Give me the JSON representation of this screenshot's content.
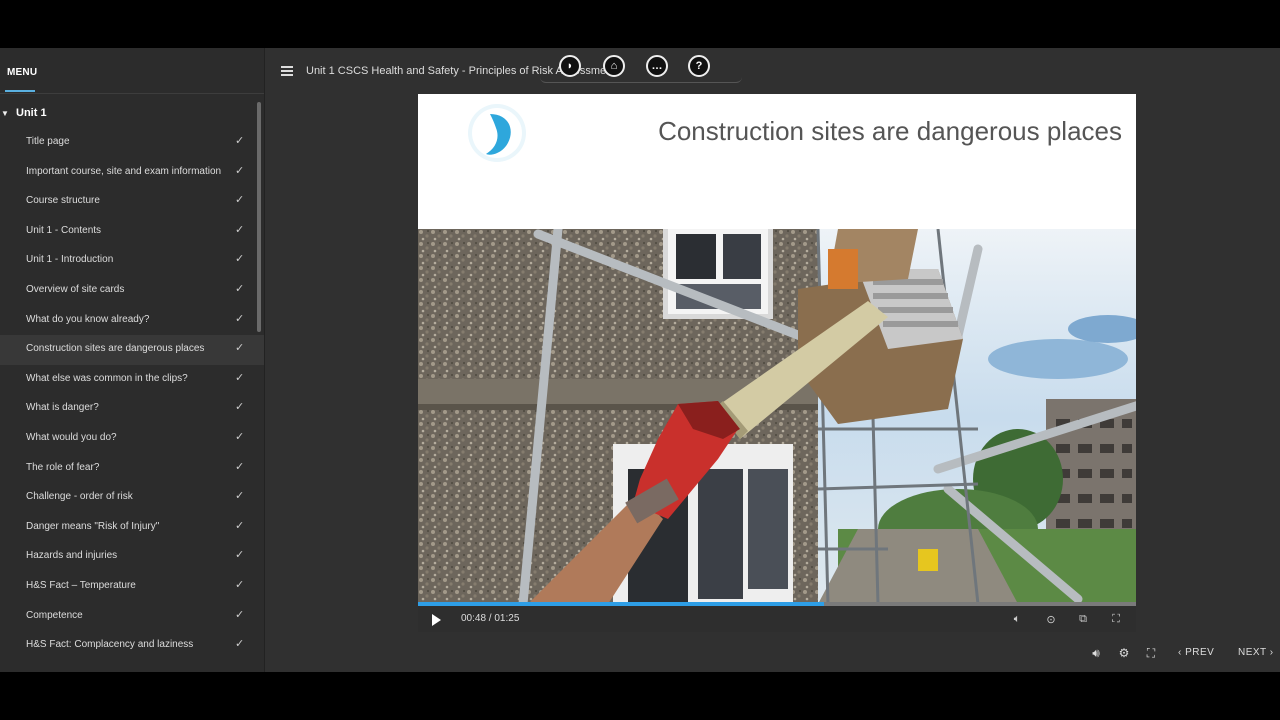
{
  "sidebar": {
    "menu_label": "MENU",
    "unit_label": "Unit 1",
    "items": [
      {
        "label": "Title page",
        "done": "✓"
      },
      {
        "label": "Important course, site and exam information",
        "done": "✓"
      },
      {
        "label": "Course structure",
        "done": "✓"
      },
      {
        "label": "Unit 1 - Contents",
        "done": "✓"
      },
      {
        "label": "Unit 1 - Introduction",
        "done": "✓"
      },
      {
        "label": "Overview of site cards",
        "done": "✓"
      },
      {
        "label": "What do you know already?",
        "done": "✓"
      },
      {
        "label": "Construction sites are dangerous places",
        "done": "✓"
      },
      {
        "label": "What else was common in the clips?",
        "done": "✓"
      },
      {
        "label": "What is danger?",
        "done": "✓"
      },
      {
        "label": "What would you do?",
        "done": "✓"
      },
      {
        "label": "The role of fear?",
        "done": "✓"
      },
      {
        "label": "Challenge - order of risk",
        "done": "✓"
      },
      {
        "label": "Danger means \"Risk of Injury\"",
        "done": "✓"
      },
      {
        "label": "Hazards and injuries",
        "done": "✓"
      },
      {
        "label": "H&S Fact – Temperature",
        "done": "✓"
      },
      {
        "label": "Competence",
        "done": "✓"
      },
      {
        "label": "H&S Fact: Complacency and laziness",
        "done": "✓"
      }
    ],
    "active_index": 7
  },
  "header": {
    "course_title": "Unit 1 CSCS Health and Safety - Principles of Risk Assessment",
    "nav_buttons": [
      {
        "icon": "logo-icon",
        "glyph": "◗"
      },
      {
        "icon": "home-icon",
        "glyph": "⌂"
      },
      {
        "icon": "chat-icon",
        "glyph": "…"
      },
      {
        "icon": "help-icon",
        "glyph": "?"
      }
    ]
  },
  "slide": {
    "title": "Construction sites are dangerous places"
  },
  "video": {
    "time": "00:48 / 01:25",
    "progress": 0.565,
    "progress_color": "#2e9ee6"
  },
  "footer": {
    "prev_label": "PREV",
    "next_label": "NEXT"
  },
  "colors": {
    "accent": "#5ab0e0",
    "sidebar_bg": "#2c2c2c",
    "app_bg": "#303030"
  }
}
